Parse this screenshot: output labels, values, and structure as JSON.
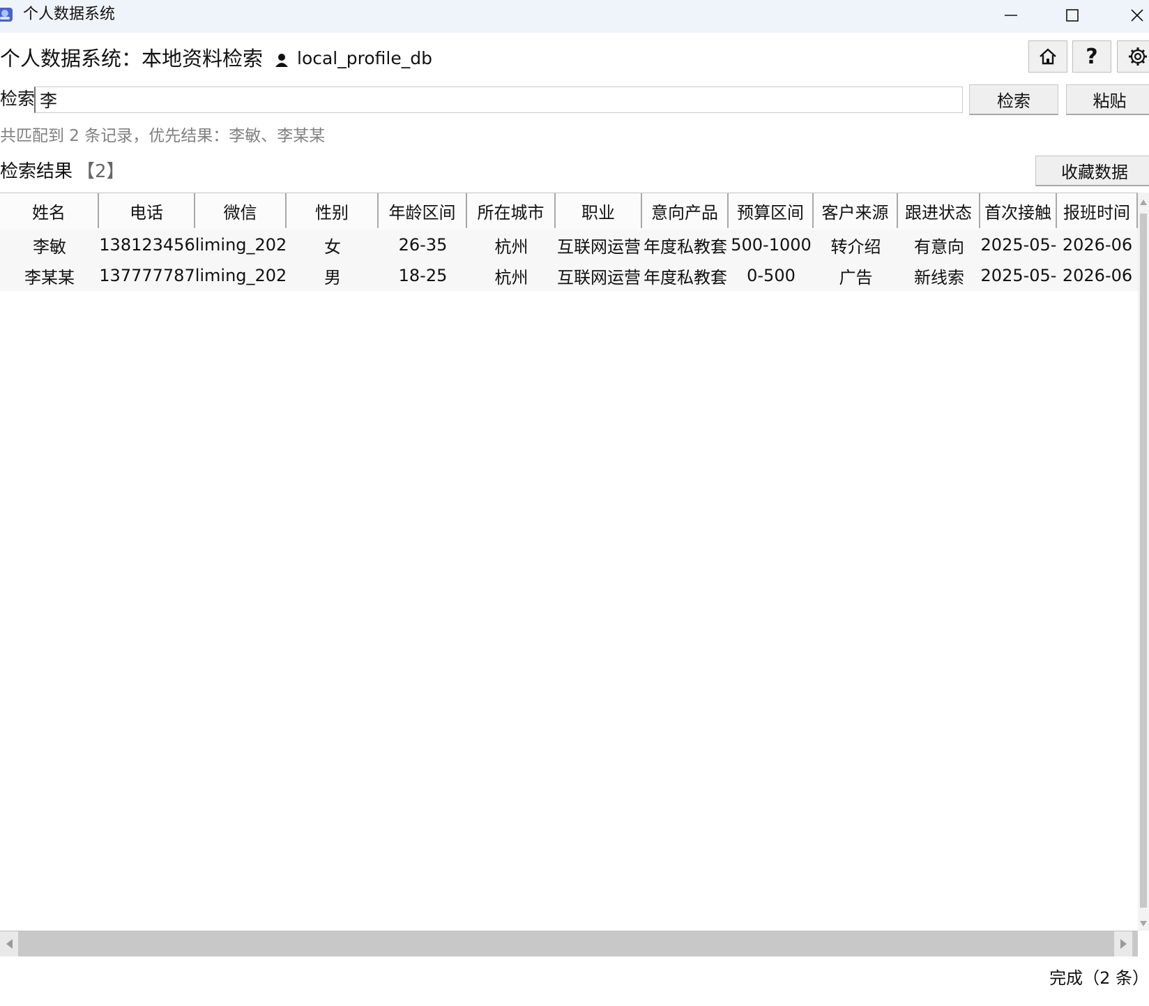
{
  "window": {
    "title": "个人数据系统"
  },
  "header": {
    "title": "个人数据系统：本地资料检索",
    "db_name": "local_profile_db"
  },
  "toolbar": {
    "home_icon": "home-icon",
    "help_label": "?",
    "settings_icon": "gear-icon"
  },
  "search": {
    "label": "检索",
    "value": "李",
    "search_button": "检索",
    "paste_button": "粘贴"
  },
  "summary": "共匹配到 2 条记录，优先结果：李敏、李某某",
  "results": {
    "title": "检索结果",
    "count": "【2】",
    "favorite_button": "收藏数据"
  },
  "table": {
    "columns": [
      "姓名",
      "电话",
      "微信",
      "性别",
      "年龄区间",
      "所在城市",
      "职业",
      "意向产品",
      "预算区间",
      "客户来源",
      "跟进状态",
      "首次接触",
      "报班时间"
    ],
    "rows": [
      [
        "李敏",
        "138123456",
        "liming_202",
        "女",
        "26-35",
        "杭州",
        "互联网运营",
        "年度私教套",
        "500-1000",
        "转介绍",
        "有意向",
        "2025-05-",
        "2026-06"
      ],
      [
        "李某某",
        "137777787",
        "liming_202",
        "男",
        "18-25",
        "杭州",
        "互联网运营",
        "年度私教套",
        "0-500",
        "广告",
        "新线索",
        "2025-05-",
        "2026-06"
      ]
    ]
  },
  "status": "完成（2 条）",
  "colors": {
    "titlebar_bg": "#eff4fa",
    "header_bg": "#fbfbfb",
    "row_bg": "#f7f7f7",
    "summary_text": "#808080"
  }
}
